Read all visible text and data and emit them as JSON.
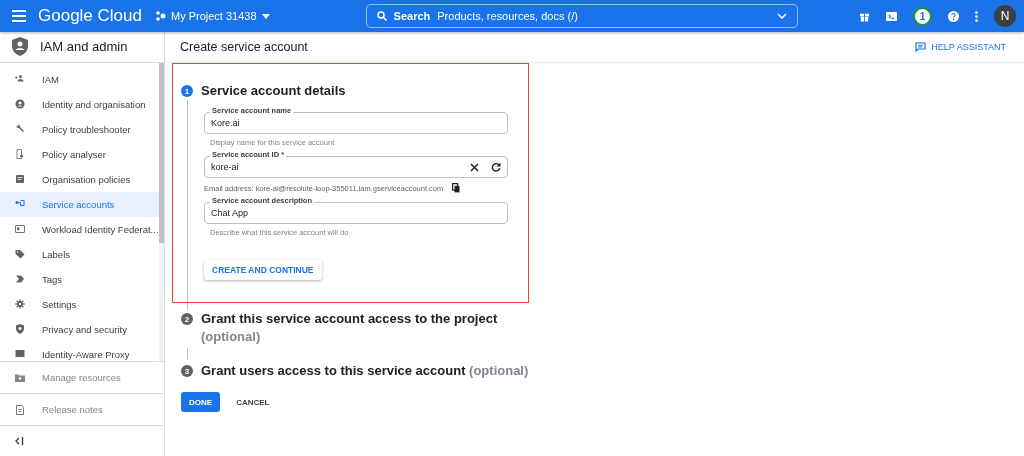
{
  "top_bar": {
    "brand": "Google Cloud",
    "project": "My Project 31438",
    "search": {
      "label": "Search",
      "placeholder": "Products, resources, docs (/)"
    },
    "notification_count": "1",
    "avatar": "N"
  },
  "sidebar": {
    "title": "IAM and admin",
    "items": [
      {
        "label": "IAM",
        "selected": false
      },
      {
        "label": "Identity and organisation",
        "selected": false
      },
      {
        "label": "Policy troubleshooter",
        "selected": false
      },
      {
        "label": "Policy analyser",
        "selected": false
      },
      {
        "label": "Organisation policies",
        "selected": false
      },
      {
        "label": "Service accounts",
        "selected": true
      },
      {
        "label": "Workload Identity Federat...",
        "selected": false
      },
      {
        "label": "Labels",
        "selected": false
      },
      {
        "label": "Tags",
        "selected": false
      },
      {
        "label": "Settings",
        "selected": false
      },
      {
        "label": "Privacy and security",
        "selected": false
      },
      {
        "label": "Identity-Aware Proxy",
        "selected": false
      }
    ],
    "footer": [
      {
        "label": "Manage resources"
      },
      {
        "label": "Release notes"
      }
    ]
  },
  "page": {
    "title": "Create service account",
    "help": "HELP ASSISTANT"
  },
  "steps": [
    {
      "number": "1",
      "title": "Service account details",
      "active": true
    },
    {
      "number": "2",
      "title": "Grant this service account access to the project",
      "optional": "(optional)",
      "active": false
    },
    {
      "number": "3",
      "title": "Grant users access to this service account",
      "optional": "(optional)",
      "active": false
    }
  ],
  "form": {
    "fields": [
      {
        "label": "Service account name",
        "value": "Kore.ai",
        "hint": "Display name for this service account",
        "actions": false
      },
      {
        "label": "Service account ID *",
        "value": "kore-ai",
        "email": "Email address: kore-ai@resolute-loop-355011.iam.gserviceaccount.com",
        "actions": true
      },
      {
        "label": "Service account description",
        "value": "Chat App",
        "hint": "Describe what this service account will do",
        "actions": false
      }
    ],
    "submit": "CREATE AND CONTINUE"
  },
  "buttons": {
    "done": "DONE",
    "cancel": "CANCEL"
  }
}
